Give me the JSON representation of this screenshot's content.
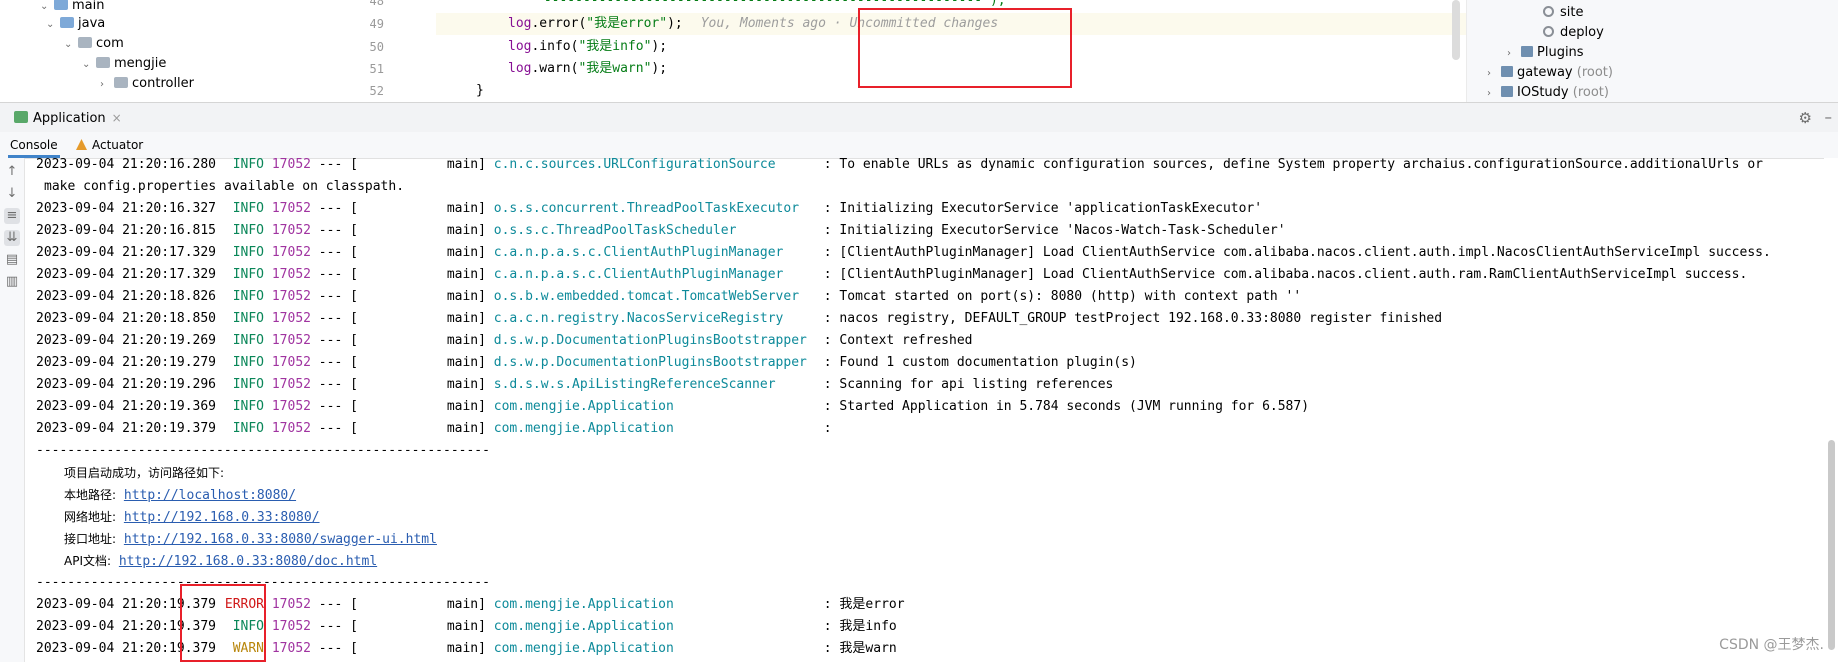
{
  "project_tree": {
    "items": [
      {
        "label": "main",
        "chevron": "⌄"
      },
      {
        "label": "java",
        "chevron": "⌄"
      },
      {
        "label": "com",
        "chevron": "⌄"
      },
      {
        "label": "mengjie",
        "chevron": "⌄"
      },
      {
        "label": "controller",
        "chevron": "›"
      }
    ]
  },
  "editor": {
    "line_numbers": [
      "48",
      "49",
      "50",
      "51",
      "52"
    ],
    "partial_line": "\"--------------------------------------------------------\");",
    "lines": [
      {
        "log": "log",
        "method": ".error(",
        "string": "\"我是error\"",
        "tail": ");"
      },
      {
        "log": "log",
        "method": ".info(",
        "string": "\"我是info\"",
        "tail": ");"
      },
      {
        "log": "log",
        "method": ".warn(",
        "string": "\"我是warn\"",
        "tail": ");"
      }
    ],
    "blame": "You, Moments ago · Uncommitted changes",
    "closing_brace": "}"
  },
  "right_tree": {
    "items": [
      {
        "label": "site",
        "suffix": ""
      },
      {
        "label": "deploy",
        "suffix": ""
      },
      {
        "label": "Plugins",
        "suffix": ""
      },
      {
        "label": "gateway",
        "suffix": " (root)"
      },
      {
        "label": "IOStudy",
        "suffix": " (root)"
      }
    ]
  },
  "run_window": {
    "tab_label": "Application",
    "close_icon": "×",
    "subtabs": {
      "console": "Console",
      "actuator": "Actuator"
    }
  },
  "console": {
    "top_line": {
      "ts": "2023-09-04 21:20:16.280",
      "level": "INFO",
      "pid": "17052",
      "sep": "--- [",
      "thread": "main]",
      "logger": "c.n.c.sources.URLConfigurationSource",
      "msg": ": To enable URLs as dynamic configuration sources, define System property archaius.configurationSource.additionalUrls or"
    },
    "wrap_line": "make config.properties available on classpath.",
    "entries": [
      {
        "ts": "2023-09-04 21:20:16.327",
        "level": "INFO",
        "pid": "17052",
        "thread": "main]",
        "logger": "o.s.s.concurrent.ThreadPoolTaskExecutor",
        "msg": ": Initializing ExecutorService 'applicationTaskExecutor'"
      },
      {
        "ts": "2023-09-04 21:20:16.815",
        "level": "INFO",
        "pid": "17052",
        "thread": "main]",
        "logger": "o.s.s.c.ThreadPoolTaskScheduler",
        "msg": ": Initializing ExecutorService 'Nacos-Watch-Task-Scheduler'"
      },
      {
        "ts": "2023-09-04 21:20:17.329",
        "level": "INFO",
        "pid": "17052",
        "thread": "main]",
        "logger": "c.a.n.p.a.s.c.ClientAuthPluginManager",
        "msg": ": [ClientAuthPluginManager] Load ClientAuthService com.alibaba.nacos.client.auth.impl.NacosClientAuthServiceImpl success."
      },
      {
        "ts": "2023-09-04 21:20:17.329",
        "level": "INFO",
        "pid": "17052",
        "thread": "main]",
        "logger": "c.a.n.p.a.s.c.ClientAuthPluginManager",
        "msg": ": [ClientAuthPluginManager] Load ClientAuthService com.alibaba.nacos.client.auth.ram.RamClientAuthServiceImpl success."
      },
      {
        "ts": "2023-09-04 21:20:18.826",
        "level": "INFO",
        "pid": "17052",
        "thread": "main]",
        "logger": "o.s.b.w.embedded.tomcat.TomcatWebServer",
        "msg": ": Tomcat started on port(s): 8080 (http) with context path ''"
      },
      {
        "ts": "2023-09-04 21:20:18.850",
        "level": "INFO",
        "pid": "17052",
        "thread": "main]",
        "logger": "c.a.c.n.registry.NacosServiceRegistry",
        "msg": ": nacos registry, DEFAULT_GROUP testProject 192.168.0.33:8080 register finished"
      },
      {
        "ts": "2023-09-04 21:20:19.269",
        "level": "INFO",
        "pid": "17052",
        "thread": "main]",
        "logger": "d.s.w.p.DocumentationPluginsBootstrapper",
        "msg": ": Context refreshed"
      },
      {
        "ts": "2023-09-04 21:20:19.279",
        "level": "INFO",
        "pid": "17052",
        "thread": "main]",
        "logger": "d.s.w.p.DocumentationPluginsBootstrapper",
        "msg": ": Found 1 custom documentation plugin(s)"
      },
      {
        "ts": "2023-09-04 21:20:19.296",
        "level": "INFO",
        "pid": "17052",
        "thread": "main]",
        "logger": "s.d.s.w.s.ApiListingReferenceScanner",
        "msg": ": Scanning for api listing references"
      },
      {
        "ts": "2023-09-04 21:20:19.369",
        "level": "INFO",
        "pid": "17052",
        "thread": "main]",
        "logger": "com.mengjie.Application",
        "msg": ": Started Application in 5.784 seconds (JVM running for 6.587)"
      },
      {
        "ts": "2023-09-04 21:20:19.379",
        "level": "INFO",
        "pid": "17052",
        "thread": "main]",
        "logger": "com.mengjie.Application",
        "msg": ":"
      }
    ],
    "separator": "----------------------------------------------------------",
    "banner": {
      "title": "项目启动成功，访问路径如下:",
      "rows": [
        {
          "label": "本地路径:",
          "url": "http://localhost:8080/"
        },
        {
          "label": "网络地址:",
          "url": "http://192.168.0.33:8080/"
        },
        {
          "label": "接口地址:",
          "url": "http://192.168.0.33:8080/swagger-ui.html"
        },
        {
          "label": "API文档:",
          "url": "http://192.168.0.33:8080/doc.html"
        }
      ]
    },
    "separator2": "----------------------------------------------------------",
    "final_entries": [
      {
        "ts": "2023-09-04 21:20:19.379",
        "level": "ERROR",
        "pid": "17052",
        "thread": "main]",
        "logger": "com.mengjie.Application",
        "msg": ": 我是error"
      },
      {
        "ts": "2023-09-04 21:20:19.379",
        "level": "INFO",
        "pid": "17052",
        "thread": "main]",
        "logger": "com.mengjie.Application",
        "msg": ": 我是info"
      },
      {
        "ts": "2023-09-04 21:20:19.379",
        "level": "WARN",
        "pid": "17052",
        "thread": "main]",
        "logger": "com.mengjie.Application",
        "msg": ": 我是warn"
      }
    ]
  },
  "watermark": "CSDN @王梦杰.",
  "colors": {
    "info": "#098658",
    "error": "#d01818",
    "warn": "#b8860b",
    "pid": "#a033a0",
    "logger": "#0d8a9a",
    "highlight": "#e8202a"
  }
}
